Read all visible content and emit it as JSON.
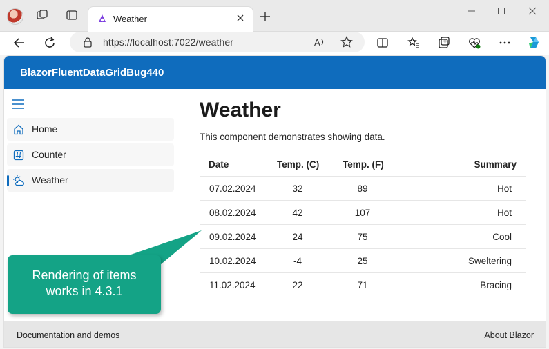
{
  "browser": {
    "tab_title": "Weather",
    "url": "https://localhost:7022/weather",
    "icons": {
      "profile": "avatar",
      "workspaces": "workspaces-icon",
      "tab_actions": "tab-actions-icon",
      "favicon": "blazor-icon",
      "close_tab": "close-icon",
      "new_tab": "plus-icon",
      "minimize": "minimize-icon",
      "maximize": "maximize-icon",
      "close_window": "close-window-icon",
      "back": "back-arrow-icon",
      "refresh": "refresh-icon",
      "lock": "lock-icon",
      "read_aloud": "read-aloud-icon",
      "favorite": "star-icon",
      "split_screen": "split-screen-icon",
      "favorites": "favorites-icon",
      "collections": "collections-icon",
      "health": "browser-essentials-icon",
      "more": "more-icon",
      "copilot": "copilot-icon"
    }
  },
  "app": {
    "title": "BlazorFluentDataGridBug440",
    "accent_color": "#0f6cbd"
  },
  "nav": {
    "menu_icon": "hamburger-icon",
    "items": [
      {
        "label": "Home",
        "icon": "home-icon",
        "active": false
      },
      {
        "label": "Counter",
        "icon": "counter-icon",
        "active": false
      },
      {
        "label": "Weather",
        "icon": "weather-icon",
        "active": true
      }
    ]
  },
  "main": {
    "title": "Weather",
    "description": "This component demonstrates showing data.",
    "grid": {
      "columns": [
        "Date",
        "Temp. (C)",
        "Temp. (F)",
        "Summary"
      ],
      "rows": [
        [
          "07.02.2024",
          "32",
          "89",
          "Hot"
        ],
        [
          "08.02.2024",
          "42",
          "107",
          "Hot"
        ],
        [
          "09.02.2024",
          "24",
          "75",
          "Cool"
        ],
        [
          "10.02.2024",
          "-4",
          "25",
          "Sweltering"
        ],
        [
          "11.02.2024",
          "22",
          "71",
          "Bracing"
        ]
      ]
    }
  },
  "footer": {
    "left": "Documentation and demos",
    "right": "About Blazor"
  },
  "callout": {
    "text": "Rendering of items\nworks in 4.3.1",
    "color": "#14a386"
  }
}
